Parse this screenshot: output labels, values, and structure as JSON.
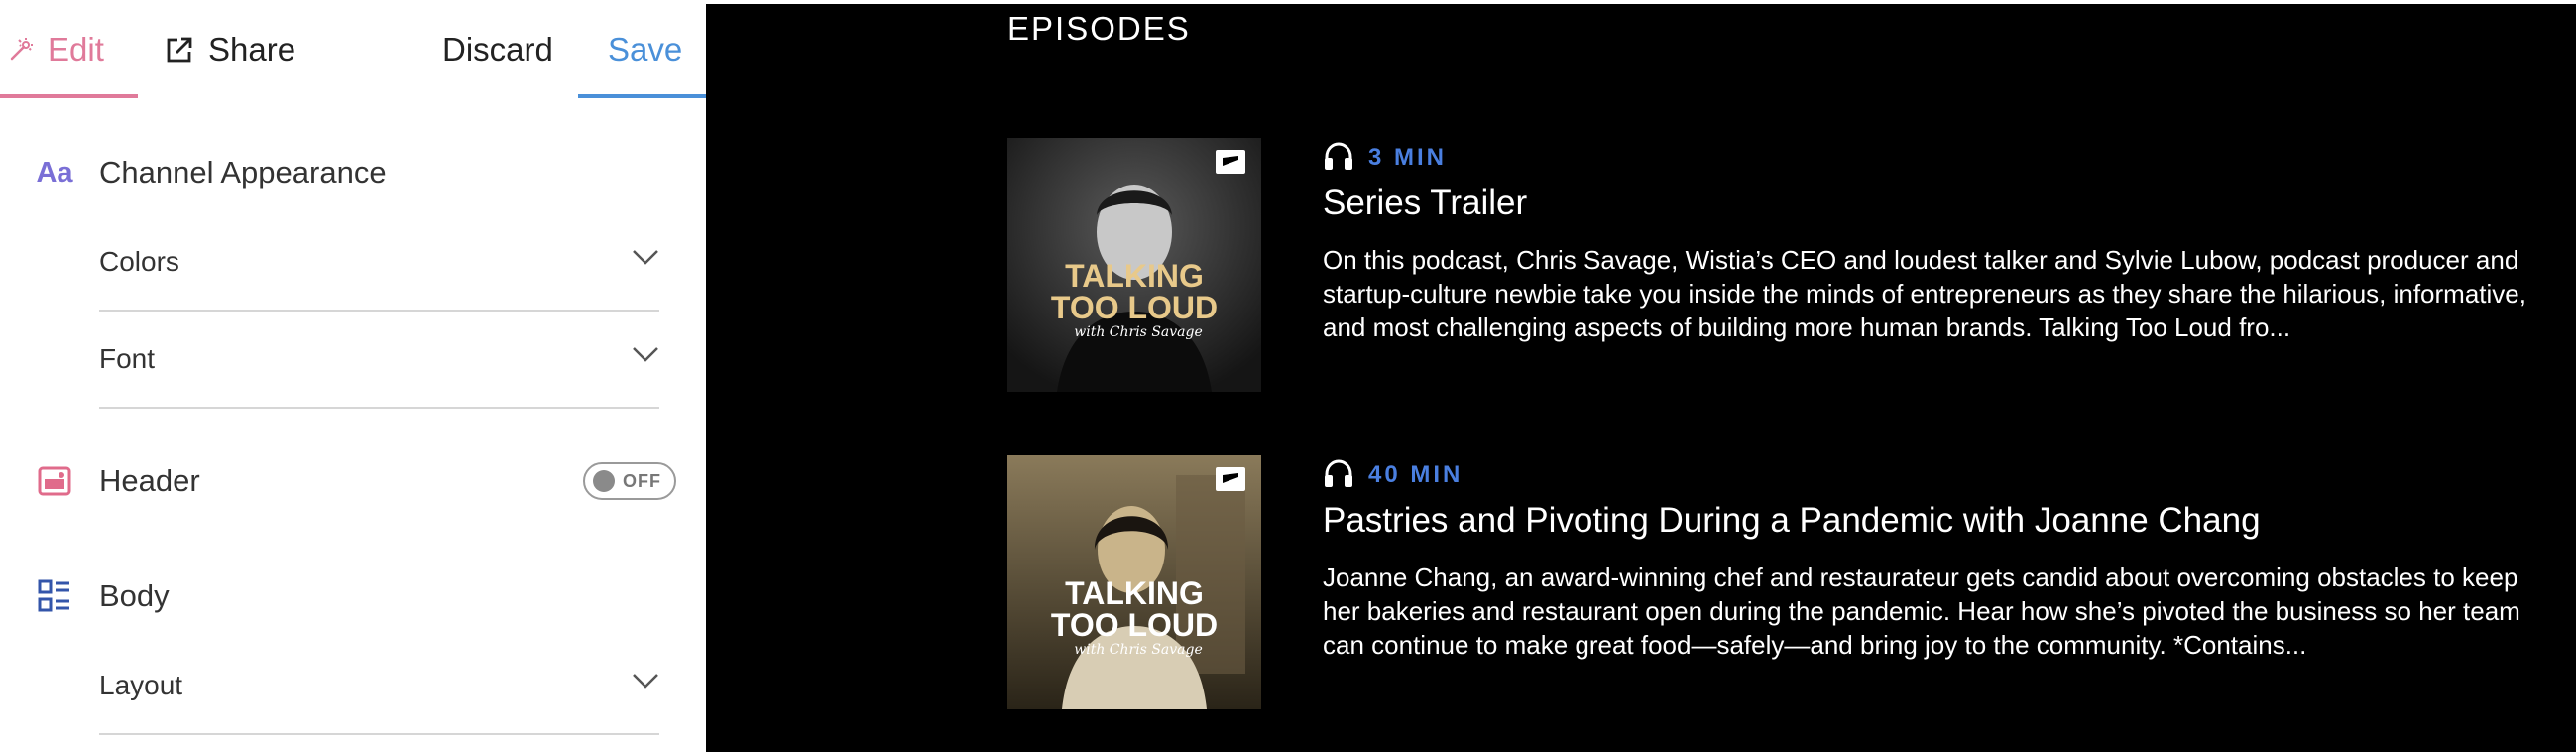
{
  "toolbar": {
    "edit_label": "Edit",
    "share_label": "Share",
    "discard_label": "Discard",
    "save_label": "Save",
    "edit_color": "#e07a9a",
    "save_color": "#4a90d9"
  },
  "editor": {
    "appearance": {
      "icon_text": "Aa",
      "title": "Channel Appearance",
      "rows": [
        {
          "label": "Colors"
        },
        {
          "label": "Font"
        }
      ]
    },
    "header": {
      "title": "Header",
      "toggle_label": "OFF",
      "toggle_on": false
    },
    "body": {
      "title": "Body",
      "rows": [
        {
          "label": "Layout"
        }
      ]
    }
  },
  "preview": {
    "heading": "EPISODES",
    "episodes": [
      {
        "duration": "3 MIN",
        "title": "Series Trailer",
        "description": "On this podcast, Chris Savage, Wistia’s CEO and loudest talker and Sylvie Lubow, podcast producer and startup-culture newbie take you inside the minds of entrepreneurs as they share the hilarious, informative, and most challenging aspects of building more human brands. Talking Too Loud fro...",
        "art_line1": "TALKING",
        "art_line2": "TOO LOUD",
        "art_line3": "with Chris Savage"
      },
      {
        "duration": "40 MIN",
        "title": "Pastries and Pivoting During a Pandemic with Joanne Chang",
        "description": "Joanne Chang, an award-winning chef and restaurateur gets candid about overcoming obstacles to keep her bakeries and restaurant open during the pandemic. Hear how she’s pivoted the business so her team can continue to make great food—safely—and bring joy to the community. *Contains...",
        "art_line1": "TALKING",
        "art_line2": "TOO LOUD",
        "art_line3": "with Chris Savage"
      }
    ]
  },
  "colors": {
    "accent_blue": "#4a7fe0",
    "preview_bg": "#000000"
  }
}
